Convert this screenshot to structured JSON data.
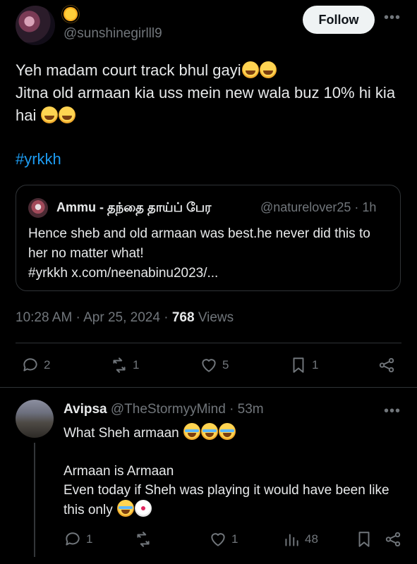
{
  "tweet": {
    "handle": "@sunshinegirlll9",
    "follow_label": "Follow",
    "text_line1": "Yeh madam court track bhul gayi",
    "text_line2": "Jitna old armaan kia uss mein new wala buz 10% hi kia hai",
    "hashtag": "#yrkkh",
    "quote": {
      "name": "Ammu - தந்தை தாய்ப் பேர",
      "handle": "@naturelover25",
      "time": "· 1h",
      "text_line1": "Hence sheb and old armaan was best.he never did this to her no matter what!",
      "text_line2": "#yrkkh x.com/neenabinu2023/..."
    },
    "time": "10:28 AM",
    "date": "Apr 25, 2024",
    "views_count": "768",
    "views_label": "Views",
    "actions": {
      "replies": "2",
      "reposts": "1",
      "likes": "5",
      "bookmarks": "1"
    }
  },
  "reply": {
    "name": "Avipsa",
    "handle": "@TheStormyyMind",
    "time": "· 53m",
    "text_line1": "What Sheh armaan",
    "text_line2": "Armaan is Armaan",
    "text_line3": "Even today if Sheh was playing it would have been like this only",
    "actions": {
      "replies": "1",
      "likes": "1",
      "views": "48"
    }
  },
  "icons": [
    "more-icon",
    "reply-icon",
    "repost-icon",
    "like-icon",
    "bookmark-icon",
    "share-icon",
    "views-icon"
  ],
  "colors": {
    "accent": "#1d9bf0",
    "muted": "#71767b",
    "text": "#e7e9ea",
    "background": "#000000"
  }
}
